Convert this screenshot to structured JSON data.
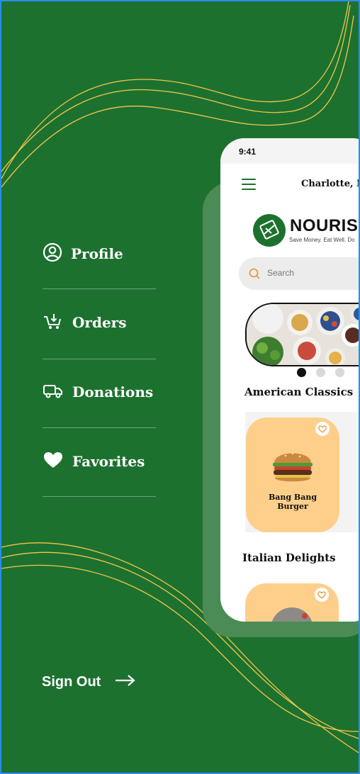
{
  "menu": {
    "items": [
      {
        "label": "Profile",
        "icon": "user-circle-icon"
      },
      {
        "label": "Orders",
        "icon": "cart-icon"
      },
      {
        "label": "Donations",
        "icon": "truck-icon"
      },
      {
        "label": "Favorites",
        "icon": "heart-icon"
      }
    ],
    "signout_label": "Sign Out"
  },
  "phone": {
    "time": "9:41",
    "location": "Charlotte, N",
    "brand": "NOURIS",
    "tagline": "Save Money. Eat Well. Do",
    "search_placeholder": "Search",
    "carousel_active_index": 0,
    "sections": [
      {
        "title": "American Classics",
        "items": [
          {
            "name_line1": "Bang Bang",
            "name_line2": "Burger"
          }
        ]
      },
      {
        "title": "Italian Delights"
      }
    ]
  },
  "colors": {
    "primary_green": "#1d712f",
    "accent_yellow": "#f0c64a",
    "card_orange": "#fecf8b",
    "search_icon": "#e8912c"
  }
}
